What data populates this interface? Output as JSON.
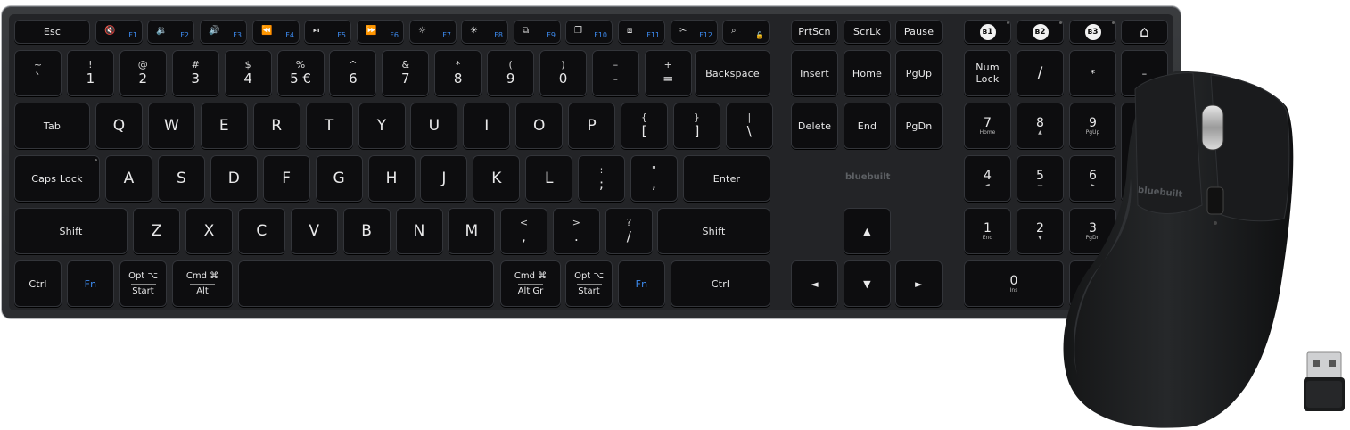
{
  "brand": "bluebuilt",
  "colors": {
    "body": "#2c2e31",
    "keycap": "#0d0d0f",
    "legend": "#e9e9ea",
    "fn_legend": "#3d8bf0",
    "backdrop": "#ffffff"
  },
  "row_f": [
    {
      "name": "esc",
      "label": "Esc"
    },
    {
      "name": "f1",
      "icon": "mute-icon",
      "glyph": "🔇",
      "fn": "F1"
    },
    {
      "name": "f2",
      "icon": "volume-down-icon",
      "glyph": "🔉",
      "fn": "F2"
    },
    {
      "name": "f3",
      "icon": "volume-up-icon",
      "glyph": "🔊",
      "fn": "F3"
    },
    {
      "name": "f4",
      "icon": "previous-track-icon",
      "glyph": "⏪",
      "fn": "F4"
    },
    {
      "name": "f5",
      "icon": "play-pause-icon",
      "glyph": "⏯",
      "fn": "F5"
    },
    {
      "name": "f6",
      "icon": "next-track-icon",
      "glyph": "⏩",
      "fn": "F6"
    },
    {
      "name": "f7",
      "icon": "brightness-down-icon",
      "glyph": "☼",
      "fn": "F7"
    },
    {
      "name": "f8",
      "icon": "brightness-up-icon",
      "glyph": "☀",
      "fn": "F8"
    },
    {
      "name": "f9",
      "icon": "screenshot-icon",
      "glyph": "⧉",
      "fn": "F9"
    },
    {
      "name": "f10",
      "icon": "window-icon",
      "glyph": "❐",
      "fn": "F10"
    },
    {
      "name": "f11",
      "icon": "desktop-icon",
      "glyph": "⧈",
      "fn": "F11"
    },
    {
      "name": "f12",
      "icon": "cut-icon",
      "glyph": "✂",
      "fn": "F12"
    },
    {
      "name": "search-lock",
      "icon": "search-icon",
      "glyph": "⌕",
      "lock_glyph": "🔒"
    }
  ],
  "row_f_right": [
    "PrtScn",
    "ScrLk",
    "Pause"
  ],
  "bt_keys": [
    "ʙ1",
    "ʙ2",
    "ʙ3"
  ],
  "home_glyph": "⌂",
  "row_num": [
    {
      "t": "~",
      "b": "`"
    },
    {
      "t": "!",
      "b": "1"
    },
    {
      "t": "@",
      "b": "2"
    },
    {
      "t": "#",
      "b": "3"
    },
    {
      "t": "$",
      "b": "4"
    },
    {
      "t": "%",
      "b": "5 €"
    },
    {
      "t": "^",
      "b": "6"
    },
    {
      "t": "&",
      "b": "7"
    },
    {
      "t": "*",
      "b": "8"
    },
    {
      "t": "(",
      "b": "9"
    },
    {
      "t": ")",
      "b": "0"
    },
    {
      "t": "–",
      "b": "-"
    },
    {
      "t": "+",
      "b": "="
    }
  ],
  "backspace": "Backspace",
  "nav_row1": [
    "Insert",
    "Home",
    "PgUp"
  ],
  "nav_row2": [
    "Delete",
    "End",
    "PgDn"
  ],
  "tab": "Tab",
  "row_q": [
    "Q",
    "W",
    "E",
    "R",
    "T",
    "Y",
    "U",
    "I",
    "O",
    "P"
  ],
  "row_q_sym": [
    {
      "t": "{",
      "b": "["
    },
    {
      "t": "}",
      "b": "]"
    },
    {
      "t": "|",
      "b": "\\"
    }
  ],
  "caps": "Caps Lock",
  "row_a": [
    "A",
    "S",
    "D",
    "F",
    "G",
    "H",
    "J",
    "K",
    "L"
  ],
  "row_a_sym": [
    {
      "t": ":",
      "b": ";"
    },
    {
      "t": "\"",
      "b": ","
    }
  ],
  "enter": "Enter",
  "shift": "Shift",
  "row_z": [
    "Z",
    "X",
    "C",
    "V",
    "B",
    "N",
    "M"
  ],
  "row_z_sym": [
    {
      "t": "<",
      "b": ","
    },
    {
      "t": ">",
      "b": "."
    },
    {
      "t": "?",
      "b": "/"
    }
  ],
  "bottom": {
    "ctrl": "Ctrl",
    "fn": "Fn",
    "opt": "Opt ⌥",
    "start": "Start",
    "cmd": "Cmd ⌘",
    "alt": "Alt",
    "altgr": "Alt Gr"
  },
  "arrows": {
    "up": "▲",
    "left": "◄",
    "down": "▼",
    "right": "►"
  },
  "numpad": {
    "numlock": "Num\nLock",
    "div": "/",
    "mul": "*",
    "minus": "–",
    "n7": "7",
    "n7s": "Home",
    "n8": "8",
    "n8s": "▲",
    "n9": "9",
    "n9s": "PgUp",
    "n4": "4",
    "n4s": "◄",
    "n5": "5",
    "n5s": "—",
    "n6": "6",
    "n6s": "►",
    "n1": "1",
    "n1s": "End",
    "n2": "2",
    "n2s": "▼",
    "n3": "3",
    "n3s": "PgDn",
    "n0": "0",
    "n0s": "Ins"
  }
}
